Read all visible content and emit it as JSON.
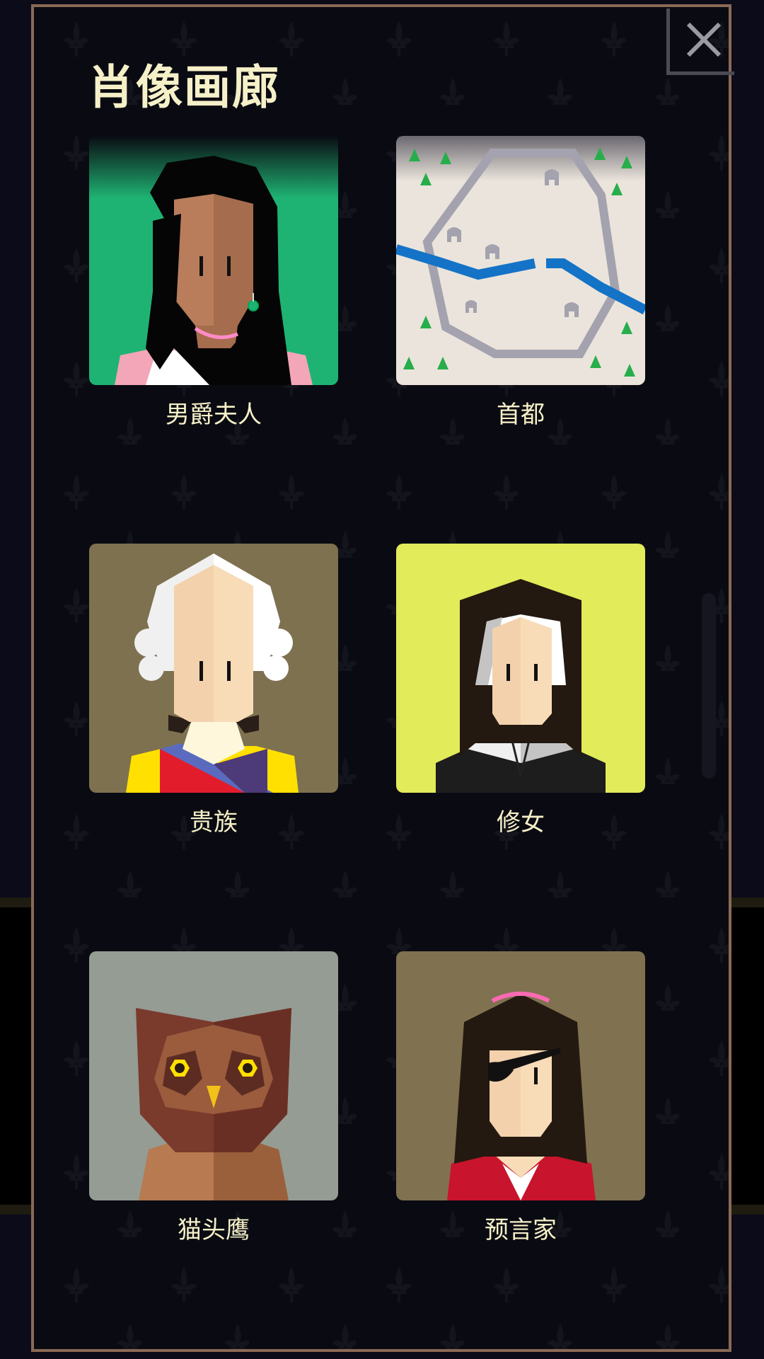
{
  "gallery": {
    "title": "肖像画廊",
    "items": [
      {
        "label": "男爵夫人",
        "background": "#1fb373"
      },
      {
        "label": "首都",
        "background": "#ebe4dc"
      },
      {
        "label": "贵族",
        "background": "#7e7150"
      },
      {
        "label": "修女",
        "background": "#e2eb5a"
      },
      {
        "label": "猫头鹰",
        "background": "#949c94"
      },
      {
        "label": "预言家",
        "background": "#807150"
      }
    ]
  },
  "icons": {
    "close": "close-icon",
    "pattern": "fleur-de-lis-icon"
  },
  "colors": {
    "frame": "#8a6a55",
    "text": "#f6f0c8",
    "panel": "#0a0b12"
  }
}
